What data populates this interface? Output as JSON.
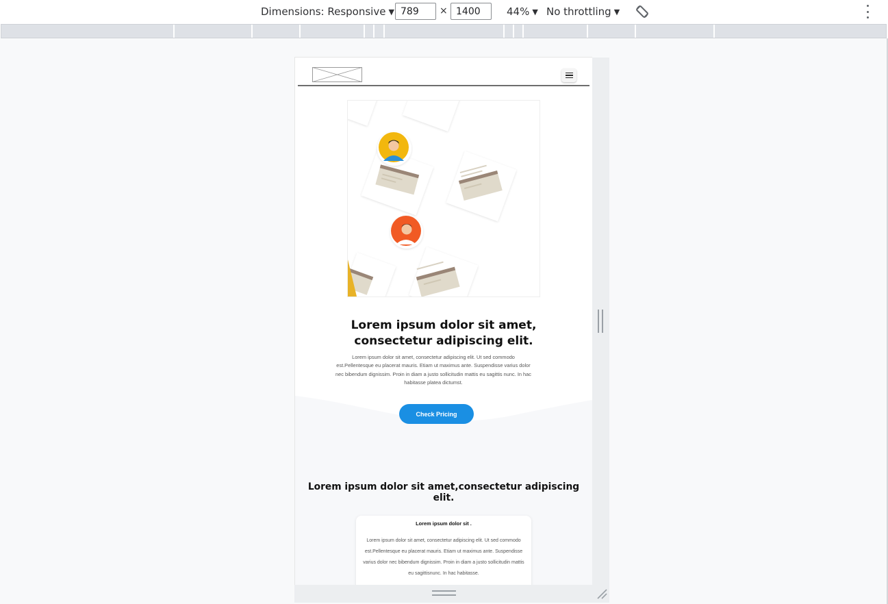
{
  "devtools": {
    "dimensions_label": "Dimensions: Responsive",
    "width_value": "789",
    "height_value": "1400",
    "times_symbol": "×",
    "zoom_label": "44%",
    "throttling_label": "No throttling",
    "caret": "▼"
  },
  "site": {
    "hero_title": "Lorem ipsum dolor sit amet, consectetur adipiscing elit.",
    "hero_text": "Lorem ipsum dolor sit amet, consectetur adipiscing elit. Ut sed commodo est.Pellentesque eu placerat mauris. Etiam ut maximus ante. Suspendisse varius dolor nec bibendum dignissim. Proin in diam a justo sollicitudin mattis eu sagittis nunc. In hac habitasse platea dictumst.",
    "cta_label": "Check Pricing",
    "section_title": "Lorem ipsum dolor sit amet,consectetur adipiscing elit.",
    "card": {
      "title": "Lorem ipsum dolor sit .",
      "text": "Lorem ipsum dolor sit amet, consectetur adipiscing elit. Ut sed commodo est.Pellentesque eu placerat mauris. Etiam ut maximus ante. Suspendisse varius dolor nec bibendum dignissim. Proin in diam a justo sollicitudin mattis eu sagittisnunc. In hac habitasse."
    }
  },
  "colors": {
    "cta_blue": "#1a8fe3",
    "avatar_yellow": "#f2b70e",
    "avatar_orange": "#f15a24",
    "wave_gray": "#f7f8fa"
  }
}
